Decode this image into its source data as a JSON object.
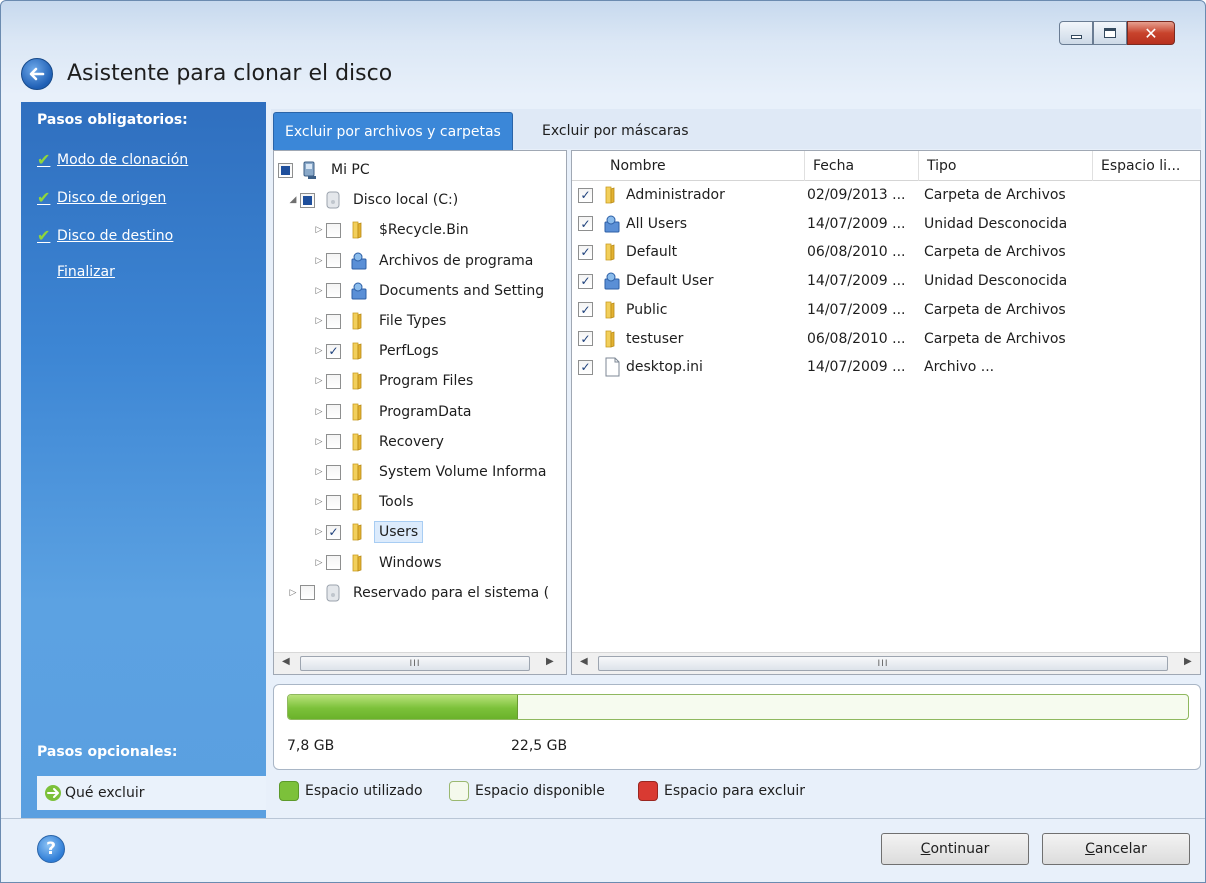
{
  "window": {
    "title": "Asistente para clonar el disco",
    "caption_close": "✕"
  },
  "sidebar": {
    "required_heading": "Pasos obligatorios:",
    "steps": [
      {
        "label": "Modo de clonación",
        "done": true
      },
      {
        "label": "Disco de origen",
        "done": true
      },
      {
        "label": "Disco de destino",
        "done": true
      },
      {
        "label": "Finalizar",
        "done": false
      }
    ],
    "optional_heading": "Pasos opcionales:",
    "optional_current": "Qué excluir"
  },
  "tabs": [
    {
      "label": "Excluir por archivos y carpetas",
      "active": true
    },
    {
      "label": "Excluir por máscaras",
      "active": false
    }
  ],
  "tree": {
    "items": [
      {
        "label": "Mi PC",
        "icon": "computer-icon",
        "state": "partial",
        "expander": ""
      },
      {
        "label": "Disco local (C:)",
        "icon": "drive-icon",
        "state": "partial",
        "expander": "◢"
      },
      {
        "label": "$Recycle.Bin",
        "icon": "folder-icon",
        "state": "unchecked",
        "expander": "▷"
      },
      {
        "label": "Archivos de programa",
        "icon": "special-folder-icon",
        "state": "unchecked",
        "expander": "▷"
      },
      {
        "label": "Documents and Setting",
        "icon": "special-folder-icon",
        "state": "unchecked",
        "expander": "▷"
      },
      {
        "label": "File Types",
        "icon": "folder-icon",
        "state": "unchecked",
        "expander": "▷"
      },
      {
        "label": "PerfLogs",
        "icon": "folder-icon",
        "state": "checked",
        "expander": "▷"
      },
      {
        "label": "Program Files",
        "icon": "folder-icon",
        "state": "unchecked",
        "expander": "▷"
      },
      {
        "label": "ProgramData",
        "icon": "folder-icon",
        "state": "unchecked",
        "expander": "▷"
      },
      {
        "label": "Recovery",
        "icon": "folder-icon",
        "state": "unchecked",
        "expander": "▷"
      },
      {
        "label": "System Volume Informa",
        "icon": "folder-icon",
        "state": "unchecked",
        "expander": "▷"
      },
      {
        "label": "Tools",
        "icon": "folder-icon",
        "state": "unchecked",
        "expander": "▷"
      },
      {
        "label": "Users",
        "icon": "folder-icon",
        "state": "checked",
        "expander": "▷",
        "selected": true
      },
      {
        "label": "Windows",
        "icon": "folder-icon",
        "state": "unchecked",
        "expander": "▷"
      },
      {
        "label": "Reservado para el sistema (",
        "icon": "drive-icon",
        "state": "unchecked",
        "expander": "▷"
      }
    ]
  },
  "list": {
    "columns": [
      "Nombre",
      "Fecha",
      "Tipo",
      "Espacio li..."
    ],
    "rows": [
      {
        "name": "Administrador",
        "date": "02/09/2013 ...",
        "type": "Carpeta de Archivos",
        "icon": "folder-icon"
      },
      {
        "name": "All Users",
        "date": "14/07/2009 ...",
        "type": "Unidad Desconocida",
        "icon": "special-folder-icon"
      },
      {
        "name": "Default",
        "date": "06/08/2010 ...",
        "type": "Carpeta de Archivos",
        "icon": "folder-icon"
      },
      {
        "name": "Default User",
        "date": "14/07/2009 ...",
        "type": "Unidad Desconocida",
        "icon": "special-folder-icon"
      },
      {
        "name": "Public",
        "date": "14/07/2009 ...",
        "type": "Carpeta de Archivos",
        "icon": "folder-icon"
      },
      {
        "name": "testuser",
        "date": "06/08/2010 ...",
        "type": "Carpeta de Archivos",
        "icon": "folder-icon"
      },
      {
        "name": "desktop.ini",
        "date": "14/07/2009 ...",
        "type": "Archivo ...",
        "icon": "file-icon"
      }
    ]
  },
  "scroll_grip": "III",
  "usage": {
    "used_label": "7,8 GB",
    "total_label": "22,5 GB",
    "used_fraction": 0.255
  },
  "legend": [
    {
      "label": "Espacio utilizado",
      "color": "#7cc13a"
    },
    {
      "label": "Espacio disponible",
      "color": "#f4f9ec"
    },
    {
      "label": "Espacio para excluir",
      "color": "#d93a32"
    }
  ],
  "footer": {
    "help": "?",
    "continue_mnemonic": "C",
    "continue_rest": "ontinuar",
    "cancel_mnemonic": "C",
    "cancel_rest": "ancelar"
  },
  "colors": {
    "accent": "#3b87d8",
    "sidebar": "#3d86d4",
    "folder": "#e8b93a"
  }
}
